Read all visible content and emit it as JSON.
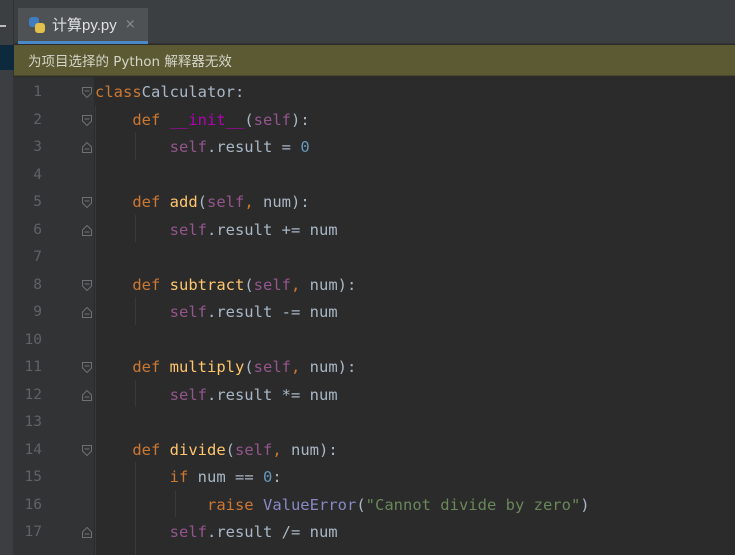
{
  "tab": {
    "file_name": "计算py.py",
    "close_glyph": "×",
    "icon": "python-file-icon"
  },
  "banner": {
    "message": "为项目选择的 Python 解释器无效"
  },
  "colors": {
    "keyword": "#cc7832",
    "function": "#ffc66d",
    "self": "#94558d",
    "magic": "#b200b2",
    "number": "#6897bb",
    "string": "#6a8759",
    "builtin": "#8888c6",
    "banner": "#5c5a33"
  },
  "lines": [
    {
      "n": "1",
      "fold": "open",
      "tokens": [
        [
          "kw",
          "class"
        ],
        [
          "",
          "Calculator:"
        ]
      ]
    },
    {
      "n": "2",
      "fold": "open",
      "tokens": [
        [
          "",
          "    "
        ],
        [
          "kw",
          "def "
        ],
        [
          "mg",
          "__init__"
        ],
        [
          "",
          "("
        ],
        [
          "sf",
          "self"
        ],
        [
          "",
          "):"
        ]
      ]
    },
    {
      "n": "3",
      "fold": "close",
      "tokens": [
        [
          "",
          "        "
        ],
        [
          "sf",
          "self"
        ],
        [
          "",
          ".result = "
        ],
        [
          "nm",
          "0"
        ]
      ]
    },
    {
      "n": "4",
      "fold": "",
      "tokens": []
    },
    {
      "n": "5",
      "fold": "open",
      "tokens": [
        [
          "",
          "    "
        ],
        [
          "kw",
          "def "
        ],
        [
          "fn",
          "add"
        ],
        [
          "",
          "("
        ],
        [
          "sf",
          "self"
        ],
        [
          "kw",
          ", "
        ],
        [
          "",
          "num):"
        ]
      ]
    },
    {
      "n": "6",
      "fold": "close",
      "tokens": [
        [
          "",
          "        "
        ],
        [
          "sf",
          "self"
        ],
        [
          "",
          ".result += num"
        ]
      ]
    },
    {
      "n": "7",
      "fold": "",
      "tokens": []
    },
    {
      "n": "8",
      "fold": "open",
      "tokens": [
        [
          "",
          "    "
        ],
        [
          "kw",
          "def "
        ],
        [
          "fn",
          "subtract"
        ],
        [
          "",
          "("
        ],
        [
          "sf",
          "self"
        ],
        [
          "kw",
          ", "
        ],
        [
          "",
          "num):"
        ]
      ]
    },
    {
      "n": "9",
      "fold": "close",
      "tokens": [
        [
          "",
          "        "
        ],
        [
          "sf",
          "self"
        ],
        [
          "",
          ".result -= num"
        ]
      ]
    },
    {
      "n": "10",
      "fold": "",
      "tokens": []
    },
    {
      "n": "11",
      "fold": "open",
      "tokens": [
        [
          "",
          "    "
        ],
        [
          "kw",
          "def "
        ],
        [
          "fn",
          "multiply"
        ],
        [
          "",
          "("
        ],
        [
          "sf",
          "self"
        ],
        [
          "kw",
          ", "
        ],
        [
          "",
          "num):"
        ]
      ]
    },
    {
      "n": "12",
      "fold": "close",
      "tokens": [
        [
          "",
          "        "
        ],
        [
          "sf",
          "self"
        ],
        [
          "",
          ".result *= num"
        ]
      ]
    },
    {
      "n": "13",
      "fold": "",
      "tokens": []
    },
    {
      "n": "14",
      "fold": "open",
      "tokens": [
        [
          "",
          "    "
        ],
        [
          "kw",
          "def "
        ],
        [
          "fn",
          "divide"
        ],
        [
          "",
          "("
        ],
        [
          "sf",
          "self"
        ],
        [
          "kw",
          ", "
        ],
        [
          "",
          "num):"
        ]
      ]
    },
    {
      "n": "15",
      "fold": "",
      "tokens": [
        [
          "",
          "        "
        ],
        [
          "kw",
          "if "
        ],
        [
          "",
          "num == "
        ],
        [
          "nm",
          "0"
        ],
        [
          "",
          ":"
        ]
      ]
    },
    {
      "n": "16",
      "fold": "",
      "tokens": [
        [
          "",
          "            "
        ],
        [
          "kw",
          "raise "
        ],
        [
          "bi",
          "ValueError"
        ],
        [
          "",
          "("
        ],
        [
          "st",
          "\"Cannot divide by zero\""
        ],
        [
          "",
          ")"
        ]
      ]
    },
    {
      "n": "17",
      "fold": "close",
      "tokens": [
        [
          "",
          "        "
        ],
        [
          "sf",
          "self"
        ],
        [
          "",
          ".result /= num"
        ]
      ]
    }
  ]
}
